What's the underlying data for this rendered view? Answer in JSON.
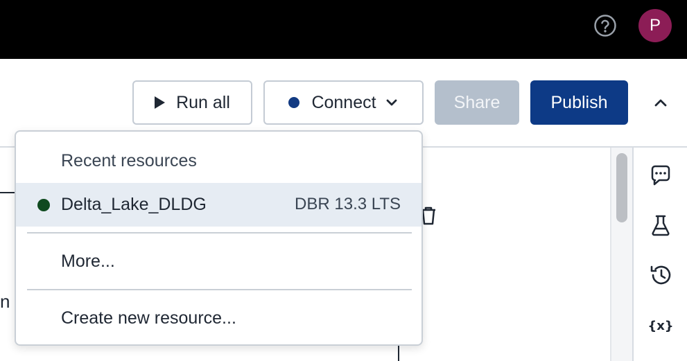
{
  "topbar": {
    "help_icon": "help-circle-icon",
    "avatar_initial": "P",
    "avatar_color": "#8c1d56"
  },
  "toolbar": {
    "run_all_label": "Run all",
    "connect_label": "Connect",
    "share_label": "Share",
    "publish_label": "Publish",
    "publish_color": "#0d3a86",
    "connect_status_color": "#123a82"
  },
  "dropdown": {
    "header": "Recent resources",
    "recent": [
      {
        "name": "Delta_Lake_DLDG",
        "runtime": "DBR 13.3 LTS",
        "status_color": "#0f4a1f"
      }
    ],
    "more_label": "More...",
    "create_label": "Create new resource..."
  },
  "background": {
    "partial_text": "n t"
  },
  "rail": {
    "icons": [
      "comment-icon",
      "experiment-flask-icon",
      "history-icon",
      "variables-icon"
    ]
  }
}
